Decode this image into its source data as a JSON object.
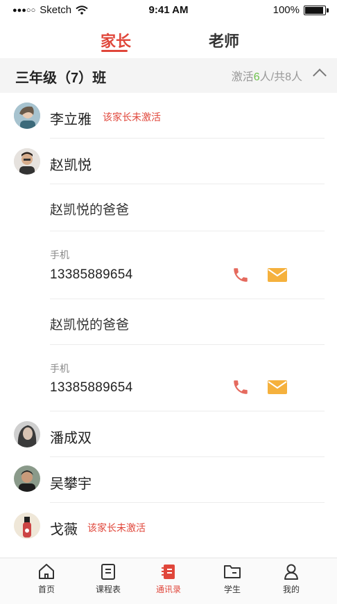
{
  "status_bar": {
    "carrier": "Sketch",
    "signal_dots": "●●●○○",
    "time": "9:41 AM",
    "battery": "100%"
  },
  "top_tabs": [
    {
      "label": "家长",
      "active": true
    },
    {
      "label": "老师",
      "active": false
    }
  ],
  "group": {
    "title": "三年级（7）班",
    "stat_prefix": "激活",
    "active_count": "6",
    "stat_mid": "人/共",
    "total_count": "8",
    "stat_suffix": "人"
  },
  "contacts": [
    {
      "name": "李立雅",
      "badge": "该家长未激活"
    },
    {
      "name": "赵凯悦",
      "badge": ""
    },
    {
      "name": "潘成双",
      "badge": ""
    },
    {
      "name": "吴攀宇",
      "badge": ""
    },
    {
      "name": "戈薇",
      "badge": "该家长未激活"
    }
  ],
  "parents": [
    {
      "name": "赵凯悦的爸爸",
      "phone_label": "手机",
      "phone": "13385889654"
    },
    {
      "name": "赵凯悦的爸爸",
      "phone_label": "手机",
      "phone": "13385889654"
    }
  ],
  "tabbar": [
    {
      "label": "首页",
      "icon": "home-icon",
      "active": false
    },
    {
      "label": "课程表",
      "icon": "schedule-icon",
      "active": false
    },
    {
      "label": "通讯录",
      "icon": "contacts-book-icon",
      "active": true
    },
    {
      "label": "学生",
      "icon": "folder-icon",
      "active": false
    },
    {
      "label": "我的",
      "icon": "user-icon",
      "active": false
    }
  ],
  "colors": {
    "accent": "#e0463a",
    "green": "#6cc04a",
    "phone_icon": "#e56a5e",
    "mail_icon": "#f5b13d"
  }
}
